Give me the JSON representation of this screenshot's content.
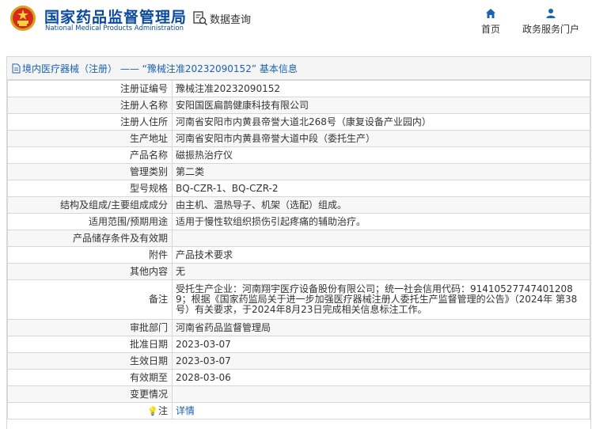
{
  "header": {
    "logo_cn": "国家药品监督管理局",
    "logo_en": "National Medical Products Administration",
    "search_label": "数据查询",
    "nav_home": "首页",
    "nav_portal": "政务服务门户"
  },
  "panel": {
    "title": "境内医疗器械（注册） —— “豫械注准20232090152” 基本信息"
  },
  "rows": [
    {
      "label": "注册证编号",
      "value": "豫械注准20232090152"
    },
    {
      "label": "注册人名称",
      "value": "安阳国医扁鹊健康科技有限公司"
    },
    {
      "label": "注册人住所",
      "value": "河南省安阳市内黄县帝誉大道北268号（康复设备产业园内）"
    },
    {
      "label": "生产地址",
      "value": "河南省安阳市内黄县帝誉大道中段（委托生产）"
    },
    {
      "label": "产品名称",
      "value": "磁振热治疗仪"
    },
    {
      "label": "管理类别",
      "value": "第二类"
    },
    {
      "label": "型号规格",
      "value": "BQ-CZR-1、BQ-CZR-2"
    },
    {
      "label": "结构及组成/主要组成成分",
      "value": "由主机、温热导子、机架（选配）组成。"
    },
    {
      "label": "适用范围/预期用途",
      "value": "适用于慢性软组织损伤引起疼痛的辅助治疗。"
    },
    {
      "label": "产品储存条件及有效期",
      "value": ""
    },
    {
      "label": "附件",
      "value": "产品技术要求"
    },
    {
      "label": "其他内容",
      "value": "无"
    },
    {
      "label": "备注",
      "value": "受托生产企业：河南翔宇医疗设备股份有限公司；统一社会信用代码：91410527747401208 9；根据《国家药监局关于进一步加强医疗器械注册人委托生产监督管理的公告》（2024年 第38号）有关要求，于2024年8月23日完成相关信息标注工作。"
    },
    {
      "label": "审批部门",
      "value": "河南省药品监督管理局"
    },
    {
      "label": "批准日期",
      "value": "2023-03-07"
    },
    {
      "label": "生效日期",
      "value": "2023-03-07"
    },
    {
      "label": "有效期至",
      "value": "2028-03-06"
    },
    {
      "label": "变更情况",
      "value": ""
    },
    {
      "label": "注",
      "value": "详情"
    }
  ]
}
